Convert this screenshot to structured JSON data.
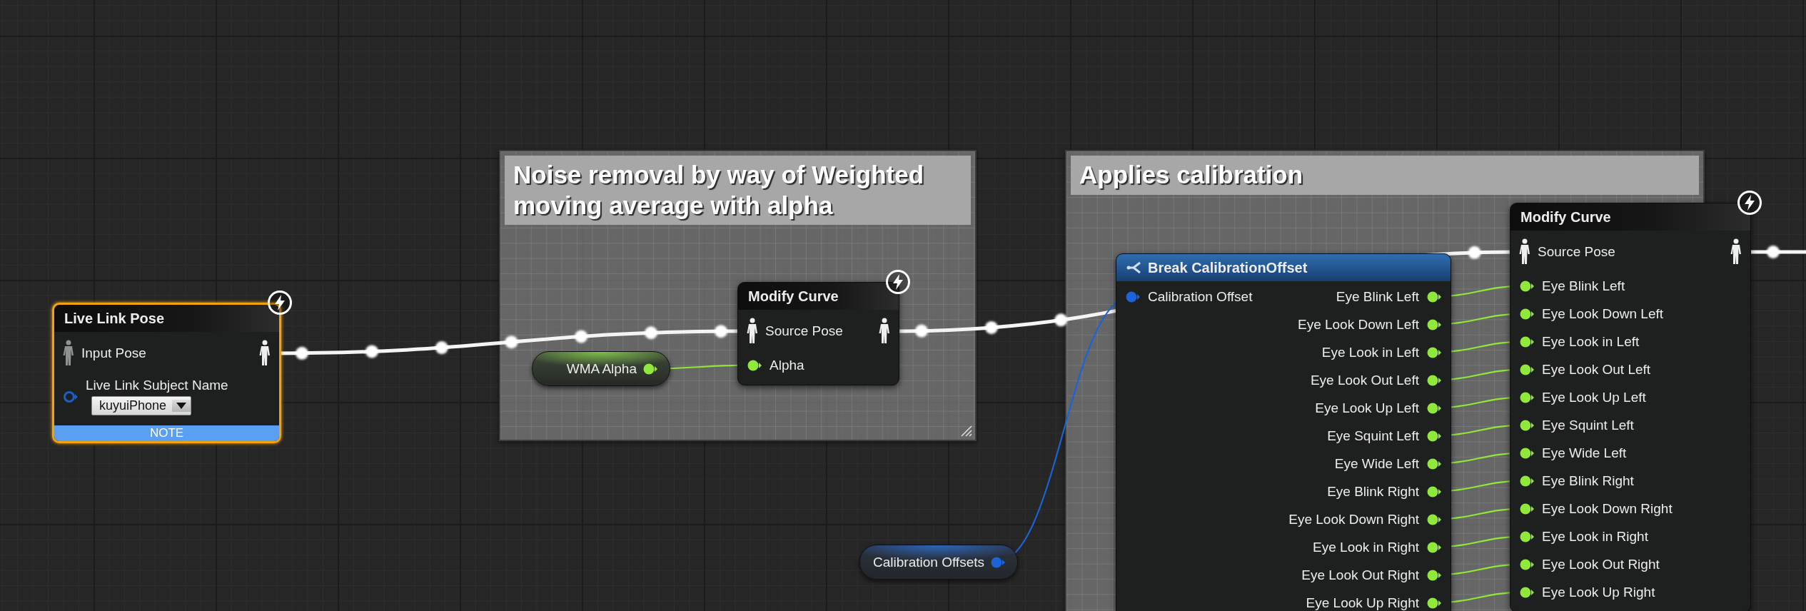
{
  "comments": [
    {
      "title": "Noise removal by way of Weighted moving average with alpha"
    },
    {
      "title": "Applies calibration"
    }
  ],
  "nodes": [
    {
      "kind": "function",
      "title": "Live Link Pose",
      "selected": true,
      "fast_path": true,
      "footer": "NOTE",
      "pins_in": [
        {
          "kind": "pose",
          "label": "Input Pose",
          "connected": false
        },
        {
          "kind": "name",
          "label": "Live Link Subject Name",
          "value": "kuyuiPhone",
          "connected": false
        }
      ],
      "pins_out": [
        {
          "kind": "pose",
          "connected": true
        }
      ]
    },
    {
      "kind": "variable",
      "title": "WMA Alpha",
      "selected": false,
      "pin": {
        "kind": "float",
        "connected": true
      }
    },
    {
      "kind": "function",
      "title": "Modify Curve",
      "selected": false,
      "fast_path": true,
      "pins_in": [
        {
          "kind": "pose",
          "label": "Source Pose",
          "connected": true
        },
        {
          "kind": "float",
          "label": "Alpha",
          "connected": true
        }
      ],
      "pins_out": [
        {
          "kind": "pose",
          "connected": true
        }
      ]
    },
    {
      "kind": "break",
      "title": "Break CalibrationOffset",
      "selected": false,
      "pins_in": [
        {
          "kind": "struct",
          "label": "Calibration Offset",
          "connected": true
        }
      ],
      "pins_out": [
        {
          "kind": "float",
          "label": "Eye Blink Left",
          "connected": true
        },
        {
          "kind": "float",
          "label": "Eye Look Down Left",
          "connected": true
        },
        {
          "kind": "float",
          "label": "Eye Look in Left",
          "connected": true
        },
        {
          "kind": "float",
          "label": "Eye Look Out Left",
          "connected": true
        },
        {
          "kind": "float",
          "label": "Eye Look Up Left",
          "connected": true
        },
        {
          "kind": "float",
          "label": "Eye Squint Left",
          "connected": true
        },
        {
          "kind": "float",
          "label": "Eye Wide Left",
          "connected": true
        },
        {
          "kind": "float",
          "label": "Eye Blink Right",
          "connected": true
        },
        {
          "kind": "float",
          "label": "Eye Look Down Right",
          "connected": true
        },
        {
          "kind": "float",
          "label": "Eye Look in Right",
          "connected": true
        },
        {
          "kind": "float",
          "label": "Eye Look Out Right",
          "connected": true
        },
        {
          "kind": "float",
          "label": "Eye Look Up Right",
          "connected": true
        }
      ]
    },
    {
      "kind": "function",
      "title": "Modify Curve",
      "selected": false,
      "fast_path": true,
      "pins_in": [
        {
          "kind": "pose",
          "label": "Source Pose",
          "connected": true
        },
        {
          "kind": "float",
          "label": "Eye Blink Left",
          "connected": true
        },
        {
          "kind": "float",
          "label": "Eye Look Down Left",
          "connected": true
        },
        {
          "kind": "float",
          "label": "Eye Look in Left",
          "connected": true
        },
        {
          "kind": "float",
          "label": "Eye Look Out Left",
          "connected": true
        },
        {
          "kind": "float",
          "label": "Eye Look Up Left",
          "connected": true
        },
        {
          "kind": "float",
          "label": "Eye Squint Left",
          "connected": true
        },
        {
          "kind": "float",
          "label": "Eye Wide Left",
          "connected": true
        },
        {
          "kind": "float",
          "label": "Eye Blink Right",
          "connected": true
        },
        {
          "kind": "float",
          "label": "Eye Look Down Right",
          "connected": true
        },
        {
          "kind": "float",
          "label": "Eye Look in Right",
          "connected": true
        },
        {
          "kind": "float",
          "label": "Eye Look Out Right",
          "connected": true
        },
        {
          "kind": "float",
          "label": "Eye Look Up Right",
          "connected": true
        }
      ],
      "pins_out": [
        {
          "kind": "pose",
          "connected": true
        }
      ]
    },
    {
      "kind": "variable",
      "title": "Calibration Offsets",
      "selected": false,
      "pin": {
        "kind": "struct",
        "connected": true
      }
    }
  ]
}
